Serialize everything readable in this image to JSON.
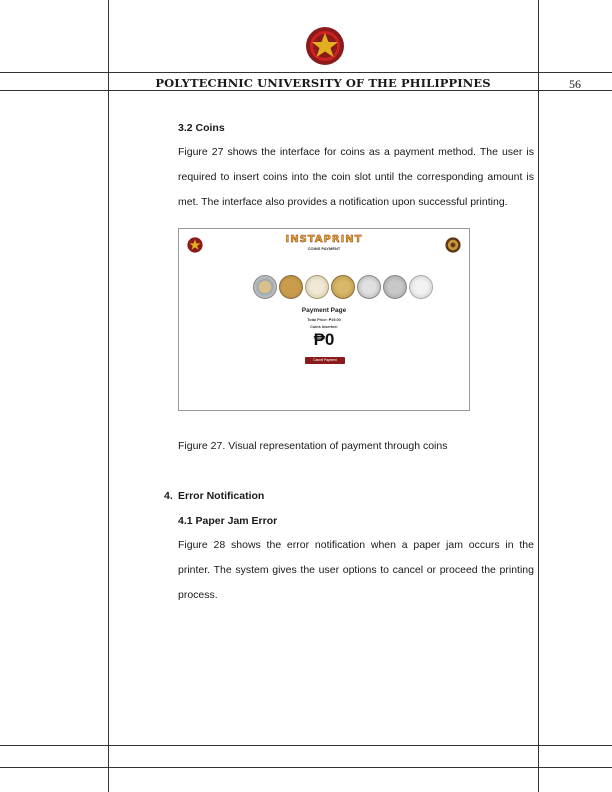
{
  "header": {
    "university": "POLYTECHNIC UNIVERSITY OF THE PHILIPPINES",
    "page_number": "56",
    "seal_icon": "university-seal-icon"
  },
  "section_3_2": {
    "heading": "3.2 Coins",
    "paragraph": "Figure 27 shows the interface for coins as a payment method. The user is required to insert coins into the coin slot until the corresponding amount is met. The interface also provides a notification upon successful printing."
  },
  "figure": {
    "app_title": "INSTAPRINT",
    "app_subtitle": "COINS PAYMENT",
    "page_title": "Payment Page",
    "total_price": "Total Price: ₱19.00",
    "coins_inserted": "Coins Inserted:",
    "amount": "₱0",
    "cancel_button": "Cancel Payment",
    "caption": "Figure 27. Visual representation of payment through coins"
  },
  "section_4": {
    "number": "4.",
    "heading": "Error Notification",
    "sub_heading": "4.1 Paper Jam Error",
    "paragraph": "Figure 28 shows the error notification when a paper jam occurs in the printer. The system gives the user options to cancel or proceed the printing process."
  },
  "colors": {
    "accent": "#8b1a1a",
    "gold": "#e0b020"
  }
}
